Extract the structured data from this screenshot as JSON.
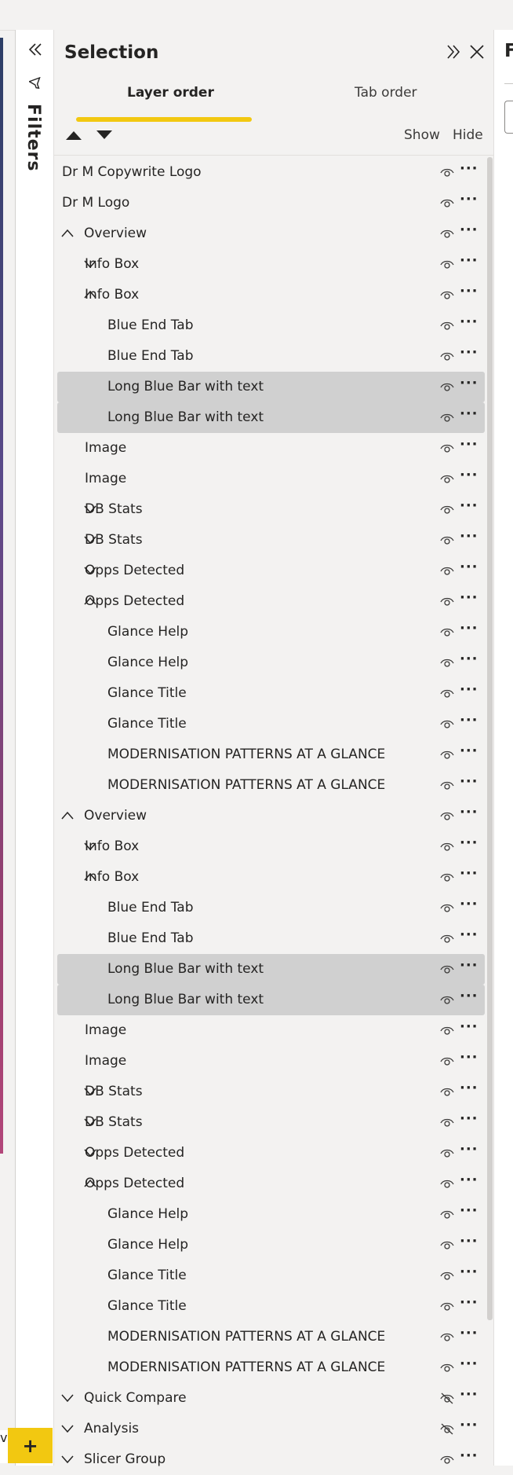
{
  "filters_rail": {
    "label": "Filters"
  },
  "selection_pane": {
    "title": "Selection",
    "tabs": [
      {
        "label": "Layer order",
        "active": true
      },
      {
        "label": "Tab order",
        "active": false
      }
    ],
    "show_label": "Show",
    "hide_label": "Hide",
    "accent_color": "#f2c811",
    "selected_row_color": "#d0d0d0",
    "items": [
      {
        "label": "Dr M Copywrite Logo",
        "level": 0,
        "chevron": "none",
        "visible": true,
        "selected": false
      },
      {
        "label": "Dr M Logo",
        "level": 0,
        "chevron": "none",
        "visible": true,
        "selected": false
      },
      {
        "label": "Overview",
        "level": 0,
        "chevron": "up",
        "visible": true,
        "selected": false
      },
      {
        "label": "Info Box",
        "level": 1,
        "chevron": "down",
        "visible": true,
        "selected": false
      },
      {
        "label": "Info Box",
        "level": 1,
        "chevron": "up",
        "visible": true,
        "selected": false
      },
      {
        "label": "Blue End Tab",
        "level": 2,
        "chevron": "none",
        "visible": true,
        "selected": false
      },
      {
        "label": "Blue End Tab",
        "level": 2,
        "chevron": "none",
        "visible": true,
        "selected": false
      },
      {
        "label": "Long Blue Bar with text",
        "level": 2,
        "chevron": "none",
        "visible": true,
        "selected": true
      },
      {
        "label": "Long Blue Bar with text",
        "level": 2,
        "chevron": "none",
        "visible": true,
        "selected": true
      },
      {
        "label": "Image",
        "level": 1,
        "chevron": "none",
        "visible": true,
        "selected": false
      },
      {
        "label": "Image",
        "level": 1,
        "chevron": "none",
        "visible": true,
        "selected": false
      },
      {
        "label": "DB Stats",
        "level": 1,
        "chevron": "down",
        "visible": true,
        "selected": false
      },
      {
        "label": "DB Stats",
        "level": 1,
        "chevron": "down",
        "visible": true,
        "selected": false
      },
      {
        "label": "Opps Detected",
        "level": 1,
        "chevron": "down",
        "visible": true,
        "selected": false
      },
      {
        "label": "Opps Detected",
        "level": 1,
        "chevron": "up",
        "visible": true,
        "selected": false
      },
      {
        "label": "Glance Help",
        "level": 2,
        "chevron": "none",
        "visible": true,
        "selected": false
      },
      {
        "label": "Glance Help",
        "level": 2,
        "chevron": "none",
        "visible": true,
        "selected": false
      },
      {
        "label": "Glance Title",
        "level": 2,
        "chevron": "none",
        "visible": true,
        "selected": false
      },
      {
        "label": "Glance Title",
        "level": 2,
        "chevron": "none",
        "visible": true,
        "selected": false
      },
      {
        "label": "MODERNISATION PATTERNS AT A GLANCE",
        "level": 2,
        "chevron": "none",
        "visible": true,
        "selected": false
      },
      {
        "label": "MODERNISATION PATTERNS AT A GLANCE",
        "level": 2,
        "chevron": "none",
        "visible": true,
        "selected": false
      },
      {
        "label": "Overview",
        "level": 0,
        "chevron": "up",
        "visible": true,
        "selected": false
      },
      {
        "label": "Info Box",
        "level": 1,
        "chevron": "down",
        "visible": true,
        "selected": false
      },
      {
        "label": "Info Box",
        "level": 1,
        "chevron": "up",
        "visible": true,
        "selected": false
      },
      {
        "label": "Blue End Tab",
        "level": 2,
        "chevron": "none",
        "visible": true,
        "selected": false
      },
      {
        "label": "Blue End Tab",
        "level": 2,
        "chevron": "none",
        "visible": true,
        "selected": false
      },
      {
        "label": "Long Blue Bar with text",
        "level": 2,
        "chevron": "none",
        "visible": true,
        "selected": true
      },
      {
        "label": "Long Blue Bar with text",
        "level": 2,
        "chevron": "none",
        "visible": true,
        "selected": true
      },
      {
        "label": "Image",
        "level": 1,
        "chevron": "none",
        "visible": true,
        "selected": false
      },
      {
        "label": "Image",
        "level": 1,
        "chevron": "none",
        "visible": true,
        "selected": false
      },
      {
        "label": "DB Stats",
        "level": 1,
        "chevron": "down",
        "visible": true,
        "selected": false
      },
      {
        "label": "DB Stats",
        "level": 1,
        "chevron": "down",
        "visible": true,
        "selected": false
      },
      {
        "label": "Opps Detected",
        "level": 1,
        "chevron": "down",
        "visible": true,
        "selected": false
      },
      {
        "label": "Opps Detected",
        "level": 1,
        "chevron": "up",
        "visible": true,
        "selected": false
      },
      {
        "label": "Glance Help",
        "level": 2,
        "chevron": "none",
        "visible": true,
        "selected": false
      },
      {
        "label": "Glance Help",
        "level": 2,
        "chevron": "none",
        "visible": true,
        "selected": false
      },
      {
        "label": "Glance Title",
        "level": 2,
        "chevron": "none",
        "visible": true,
        "selected": false
      },
      {
        "label": "Glance Title",
        "level": 2,
        "chevron": "none",
        "visible": true,
        "selected": false
      },
      {
        "label": "MODERNISATION PATTERNS AT A GLANCE",
        "level": 2,
        "chevron": "none",
        "visible": true,
        "selected": false
      },
      {
        "label": "MODERNISATION PATTERNS AT A GLANCE",
        "level": 2,
        "chevron": "none",
        "visible": true,
        "selected": false
      },
      {
        "label": "Quick Compare",
        "level": 0,
        "chevron": "down",
        "visible": false,
        "selected": false
      },
      {
        "label": "Analysis",
        "level": 0,
        "chevron": "down",
        "visible": false,
        "selected": false
      },
      {
        "label": "Slicer Group",
        "level": 0,
        "chevron": "down",
        "visible": true,
        "selected": false
      }
    ]
  },
  "more_glyph": "···",
  "next_pane": {
    "title_initial": "F"
  },
  "bottom_bar": {
    "page_tab_fragment": "ve",
    "add_page_glyph": "+"
  }
}
